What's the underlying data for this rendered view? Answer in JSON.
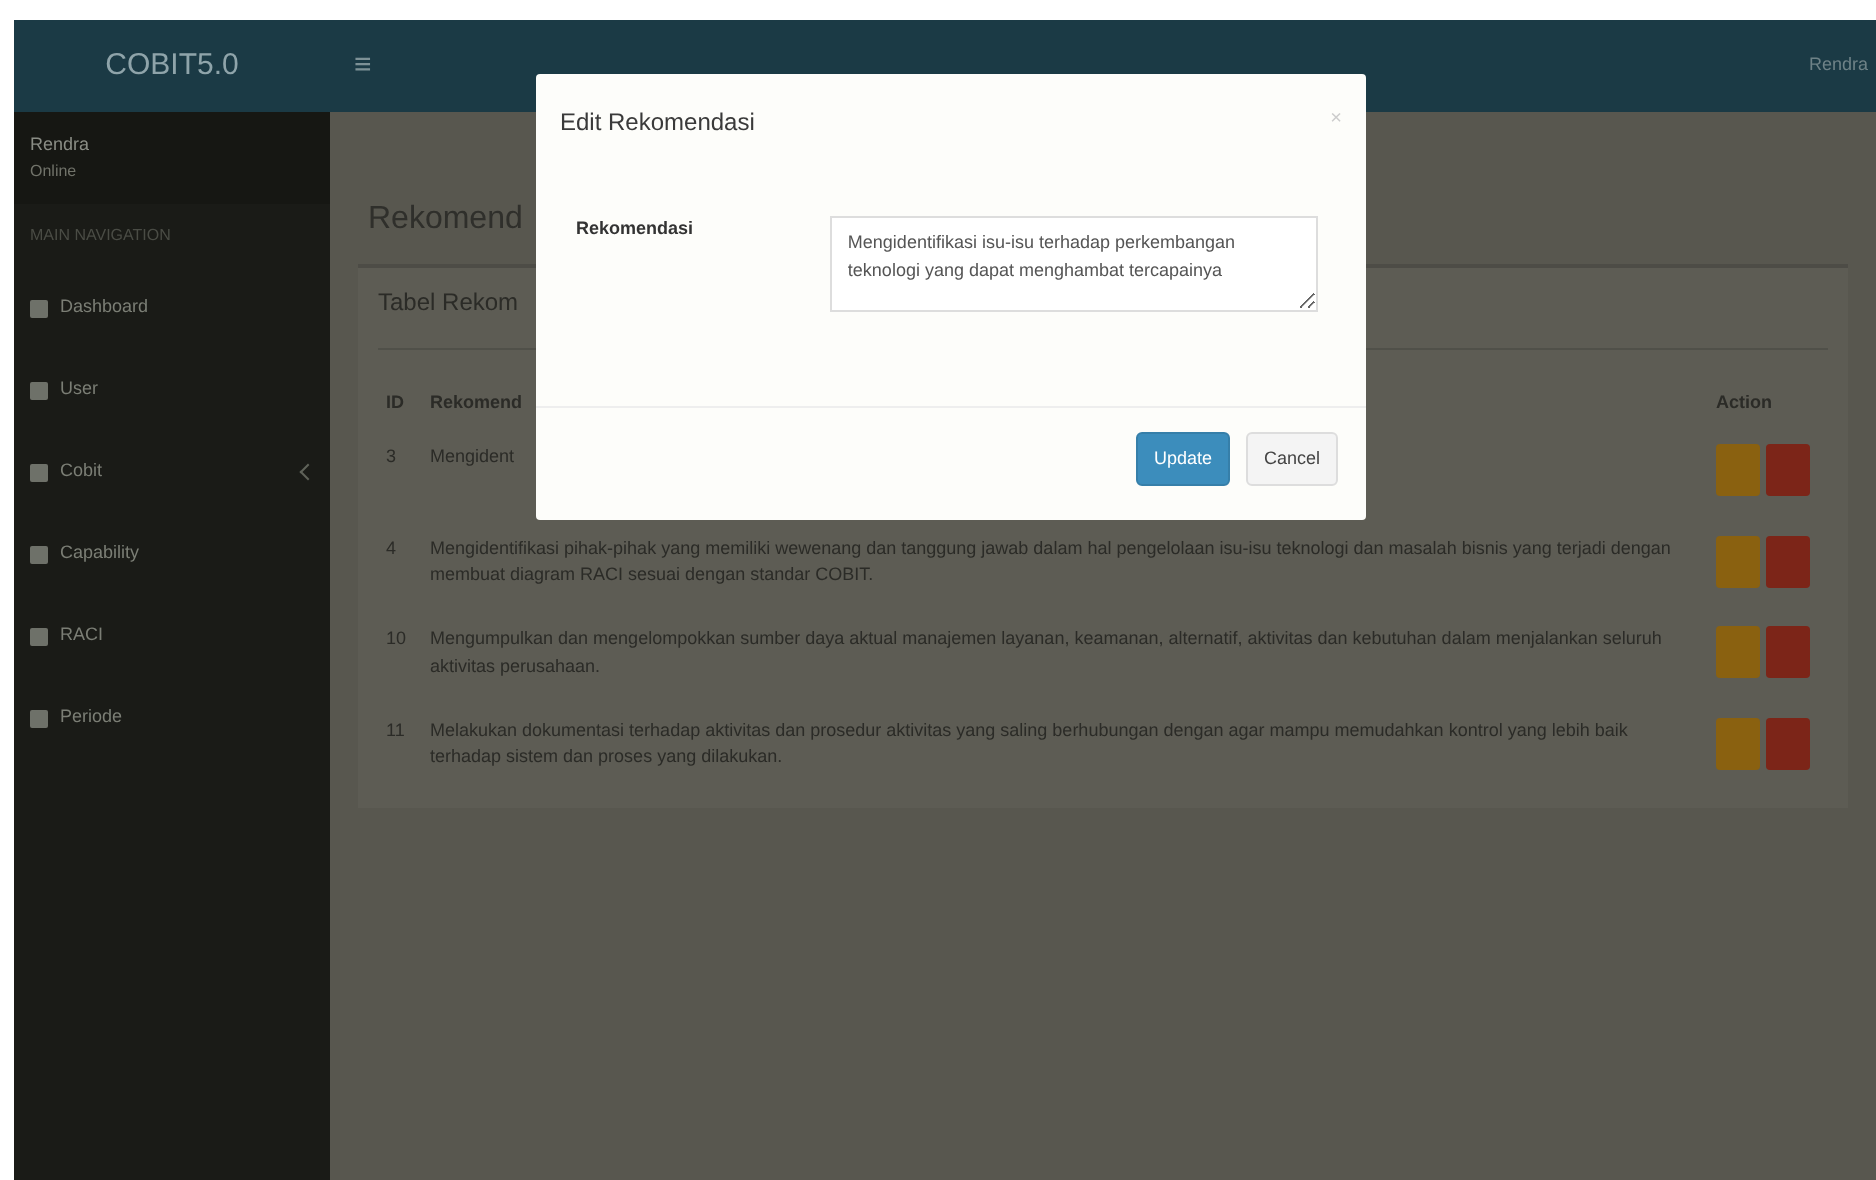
{
  "navbar": {
    "brand": "COBIT5.0",
    "menu_icon": "≡",
    "user": "Rendra"
  },
  "sidebar": {
    "user_name": "Rendra",
    "user_status": "Online",
    "section": "MAIN NAVIGATION",
    "items": [
      {
        "label": "Dashboard",
        "has_children": false
      },
      {
        "label": "User",
        "has_children": false
      },
      {
        "label": "Cobit",
        "has_children": true
      },
      {
        "label": "Capability",
        "has_children": false
      },
      {
        "label": "RACI",
        "has_children": false
      },
      {
        "label": "Periode",
        "has_children": false
      }
    ]
  },
  "page_title": "Rekomend",
  "card_title": "Tabel Rekom",
  "table": {
    "columns": [
      "ID",
      "Rekomend",
      "Action"
    ],
    "rows": [
      {
        "id": "3",
        "text": "Mengident"
      },
      {
        "id": "4",
        "text": "Mengidentifikasi pihak-pihak yang memiliki wewenang dan tanggung jawab dalam hal pengelolaan isu-isu teknologi dan masalah bisnis yang terjadi dengan membuat diagram RACI sesuai dengan standar COBIT."
      },
      {
        "id": "10",
        "text": "Mengumpulkan dan mengelompokkan sumber daya aktual manajemen layanan, keamanan, alternatif, aktivitas dan kebutuhan dalam menjalankan seluruh aktivitas perusahaan."
      },
      {
        "id": "11",
        "text": "Melakukan dokumentasi terhadap aktivitas dan prosedur aktivitas yang saling berhubungan dengan agar mampu memudahkan kontrol yang lebih baik terhadap sistem dan proses yang dilakukan."
      }
    ]
  },
  "modal": {
    "title": "Edit Rekomendasi",
    "close": "×",
    "field_label": "Rekomendasi",
    "field_value": "Mengidentifikasi isu-isu terhadap perkembangan teknologi yang dapat menghambat tercapainya",
    "buttons": [
      {
        "label": "Update",
        "kind": "primary"
      },
      {
        "label": "Cancel",
        "kind": "default"
      }
    ]
  }
}
